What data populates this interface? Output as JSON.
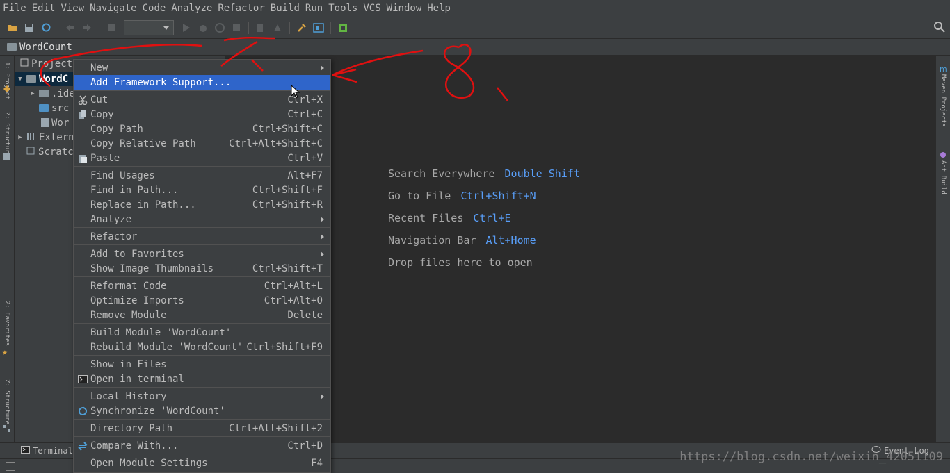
{
  "menubar": [
    "File",
    "Edit",
    "View",
    "Navigate",
    "Code",
    "Analyze",
    "Refactor",
    "Build",
    "Run",
    "Tools",
    "VCS",
    "Window",
    "Help"
  ],
  "navbar": {
    "breadcrumb": "WordCount"
  },
  "project_panel": {
    "header": "Project",
    "tree": [
      {
        "label": "WordC",
        "selected": true
      },
      {
        "label": ".ide"
      },
      {
        "label": "src"
      },
      {
        "label": "Wor"
      },
      {
        "label": "Extern"
      },
      {
        "label": "Scratc"
      }
    ]
  },
  "left_strip": {
    "top_label": "1: Project",
    "mid_label": "Z: Structure",
    "favorites_label": "2: Favorites",
    "bottom_label": "Z: Structure"
  },
  "right_strip": {
    "maven_label": "Maven Projects",
    "ant_label": "Ant Build"
  },
  "context_menu": [
    {
      "label": "New",
      "shortcut": "",
      "submenu": true
    },
    {
      "label": "Add Framework Support...",
      "shortcut": "",
      "highlighted": true
    },
    {
      "label": "Cut",
      "shortcut": "Ctrl+X",
      "icon": "scissors"
    },
    {
      "label": "Copy",
      "shortcut": "Ctrl+C",
      "icon": "copy"
    },
    {
      "label": "Copy Path",
      "shortcut": "Ctrl+Shift+C"
    },
    {
      "label": "Copy Relative Path",
      "shortcut": "Ctrl+Alt+Shift+C"
    },
    {
      "label": "Paste",
      "shortcut": "Ctrl+V",
      "icon": "paste"
    },
    {
      "label": "Find Usages",
      "shortcut": "Alt+F7"
    },
    {
      "label": "Find in Path...",
      "shortcut": "Ctrl+Shift+F"
    },
    {
      "label": "Replace in Path...",
      "shortcut": "Ctrl+Shift+R"
    },
    {
      "label": "Analyze",
      "shortcut": "",
      "submenu": true
    },
    {
      "label": "Refactor",
      "shortcut": "",
      "submenu": true
    },
    {
      "label": "Add to Favorites",
      "shortcut": "",
      "submenu": true
    },
    {
      "label": "Show Image Thumbnails",
      "shortcut": "Ctrl+Shift+T"
    },
    {
      "label": "Reformat Code",
      "shortcut": "Ctrl+Alt+L"
    },
    {
      "label": "Optimize Imports",
      "shortcut": "Ctrl+Alt+O"
    },
    {
      "label": "Remove Module",
      "shortcut": "Delete"
    },
    {
      "label": "Build Module 'WordCount'",
      "shortcut": ""
    },
    {
      "label": "Rebuild Module 'WordCount'",
      "shortcut": "Ctrl+Shift+F9"
    },
    {
      "label": "Show in Files",
      "shortcut": ""
    },
    {
      "label": "Open in terminal",
      "shortcut": "",
      "icon": "terminal"
    },
    {
      "label": "Local History",
      "shortcut": "",
      "submenu": true
    },
    {
      "label": "Synchronize 'WordCount'",
      "shortcut": "",
      "icon": "sync"
    },
    {
      "label": "Directory Path",
      "shortcut": "Ctrl+Alt+Shift+2"
    },
    {
      "label": "Compare With...",
      "shortcut": "Ctrl+D",
      "icon": "compare"
    },
    {
      "label": "Open Module Settings",
      "shortcut": "F4"
    }
  ],
  "editor_hints": [
    {
      "text": "Search Everywhere",
      "key": "Double Shift"
    },
    {
      "text": "Go to File",
      "key": "Ctrl+Shift+N"
    },
    {
      "text": "Recent Files",
      "key": "Ctrl+E"
    },
    {
      "text": "Navigation Bar",
      "key": "Alt+Home"
    },
    {
      "text": "Drop files here to open",
      "key": ""
    }
  ],
  "bottom": {
    "terminal": "Terminal",
    "event_log": "Event Log"
  },
  "watermark": "https://blog.csdn.net/weixin_42051109",
  "colors": {
    "highlight": "#2f65ca",
    "key": "#589df6",
    "annotation": "#e01010"
  }
}
